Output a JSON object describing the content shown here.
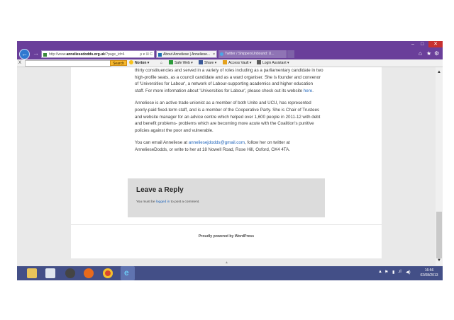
{
  "browser": {
    "url_prefix": "http://www.",
    "url_domain": "anneliesedodds.org.uk",
    "url_suffix": "/?page_id=4",
    "address_controls": "ρ ▾ ☒ C",
    "tabs": [
      {
        "label": "About Anneliese | Anneliese...",
        "close": "×"
      },
      {
        "label": "Twitter / ShippersUnbound: U..."
      }
    ],
    "window_controls": {
      "minimize": "–",
      "maximize": "□",
      "close": "✕"
    },
    "icons": {
      "back": "arrow-left",
      "forward": "arrow-right",
      "home": "home",
      "favorites": "star",
      "tools": "gear"
    }
  },
  "toolbar": {
    "close": "X",
    "search_placeholder": "",
    "search_button": "Search",
    "norton": "Norton ▾",
    "safe_web": "Safe Web ▾",
    "share": "Share ▾",
    "access_vault": "Access Vault ▾",
    "login_assistant": "Login Assistant ▾"
  },
  "article": {
    "p1": "thirty constituencies and served in a variety of roles including as a parliamentary candidate in two high-profile seats, as a council candidate and as a ward organiser. She is founder and convenor of 'Universities for Labour', a network of Labour-supporting academics and higher education staff. For more information about 'Universities for Labour', please check out its website ",
    "p1_link": "here",
    "p1_end": ".",
    "p2": "Anneliese is an active trade unionist as a member of both Unite and UCU, has represented poorly-paid fixed-term staff, and is a member of the Cooperative Party. She is Chair of Trustees and website manager for an advice centre which helped over 1,600 people in 2011-12 with debt and benefit problems- problems which are becoming more acute with the Coalition's punitive policies against the poor and vulnerable.",
    "p3_start": "You can email Anneliese at ",
    "p3_email": "anneliesejdodds@gmail.com",
    "p3_end": ", follow her on twitter at AnnelieseDodds, or write to her at 18 Nowell Road, Rose Hill, Oxford, OX4 4TA."
  },
  "reply": {
    "title": "Leave a Reply",
    "note_start": "You must be ",
    "note_link": "logged in",
    "note_end": " to post a comment."
  },
  "footer": {
    "credits": "Proudly powered by WordPress",
    "scroll_top": "▲"
  },
  "scrollbar": {
    "up": "▲",
    "down": "▼"
  },
  "taskbar": {
    "apps": [
      "file-explorer",
      "media-center",
      "mail",
      "firefox",
      "chrome",
      "internet-explorer"
    ],
    "ie_glyph": "e",
    "tray": {
      "arrow": "▲",
      "flag": "⚑",
      "battery": "▮",
      "signal": ".ıl",
      "volume": "◀)"
    },
    "time": "16:56",
    "date": "02/08/2013"
  }
}
